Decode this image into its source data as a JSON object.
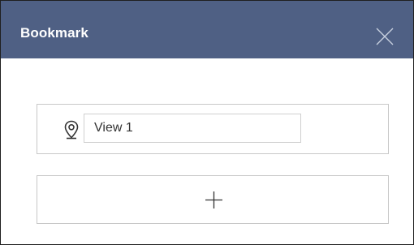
{
  "header": {
    "title": "Bookmark",
    "close_icon": "close-icon",
    "background_color": "#4f6084"
  },
  "bookmarks": [
    {
      "icon": "map-pin-icon",
      "name": "View 1"
    }
  ],
  "add_button": {
    "icon": "plus-icon"
  }
}
